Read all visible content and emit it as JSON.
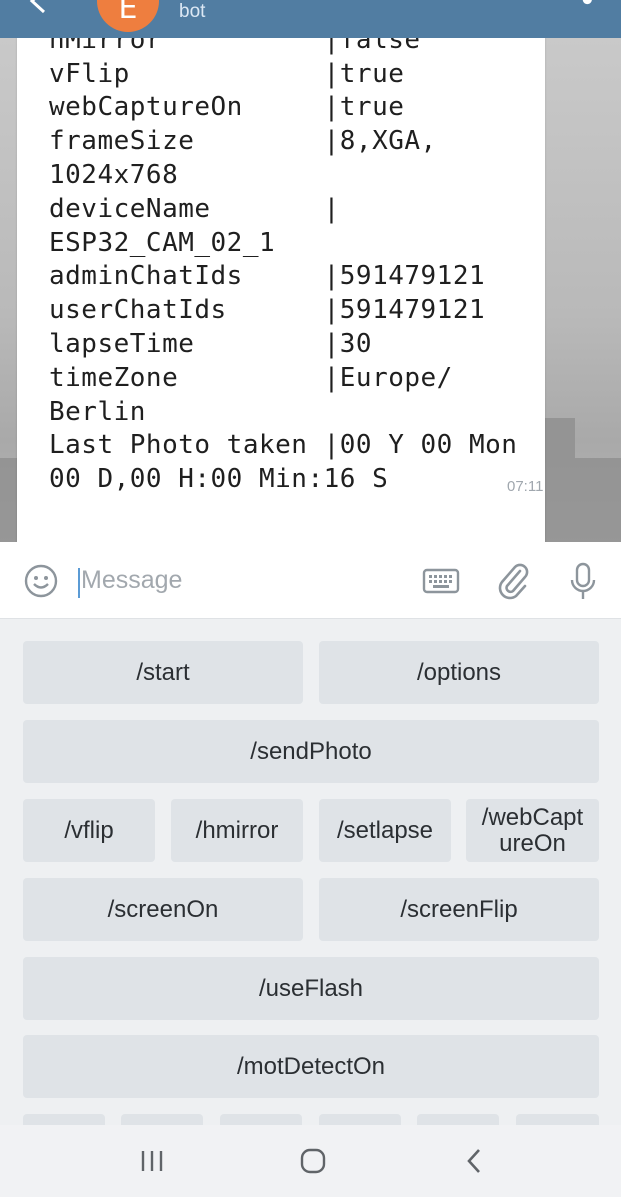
{
  "header": {
    "avatar_letter": "E",
    "subtitle": "bot"
  },
  "message": {
    "text": "motDetectOn      |false\nhMirror          |false\nvFlip            |true\nwebCaptureOn     |true\nframeSize        |8,XGA,\n1024x768\ndeviceName       |\nESP32_CAM_02_1\nadminChatIds     |591479121\nuserChatIds      |591479121\nlapseTime        |30\ntimeZone         |Europe/\nBerlin\nLast Photo taken |00 Y 00 Mon\n00 D,00 H:00 Min:16 S",
    "time": "07:11"
  },
  "input": {
    "placeholder": "Message"
  },
  "keyboard": {
    "row1": [
      "/start",
      "/options"
    ],
    "row2": [
      "/sendPhoto"
    ],
    "row3": [
      "/vflip",
      "/hmirror",
      "/setlapse",
      "/webCapt\nureOn"
    ],
    "row4": [
      "/screenOn",
      "/screenFlip"
    ],
    "row5": [
      "/useFlash"
    ],
    "row6": [
      "/motDetectOn"
    ]
  },
  "icons": {
    "emoji": "smile-icon",
    "keyboard": "keyboard-icon",
    "attach": "paperclip-icon",
    "mic": "microphone-icon",
    "nav_recents": "recents-icon",
    "nav_home": "home-icon",
    "nav_back": "back-icon"
  },
  "colors": {
    "header": "#517da2",
    "avatar": "#ee7e3f",
    "key": "#dfe3e7"
  }
}
